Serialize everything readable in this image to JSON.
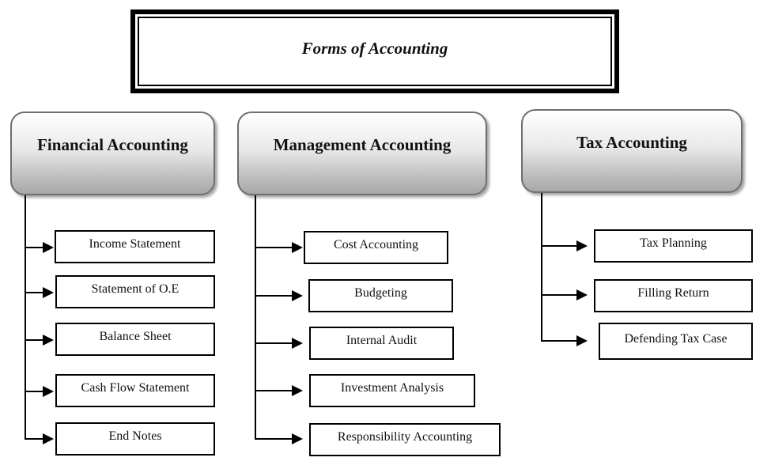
{
  "diagram": {
    "title": "Forms of Accounting",
    "categories": [
      {
        "label": "Financial Accounting",
        "items": [
          "Income Statement",
          "Statement of O.E",
          "Balance Sheet",
          "Cash Flow Statement",
          "End Notes"
        ]
      },
      {
        "label": "Management Accounting",
        "items": [
          "Cost Accounting",
          "Budgeting",
          "Internal Audit",
          "Investment Analysis",
          "Responsibility Accounting"
        ]
      },
      {
        "label": "Tax Accounting",
        "items": [
          "Tax Planning",
          "Filling Return",
          "Defending Tax Case"
        ]
      }
    ]
  }
}
